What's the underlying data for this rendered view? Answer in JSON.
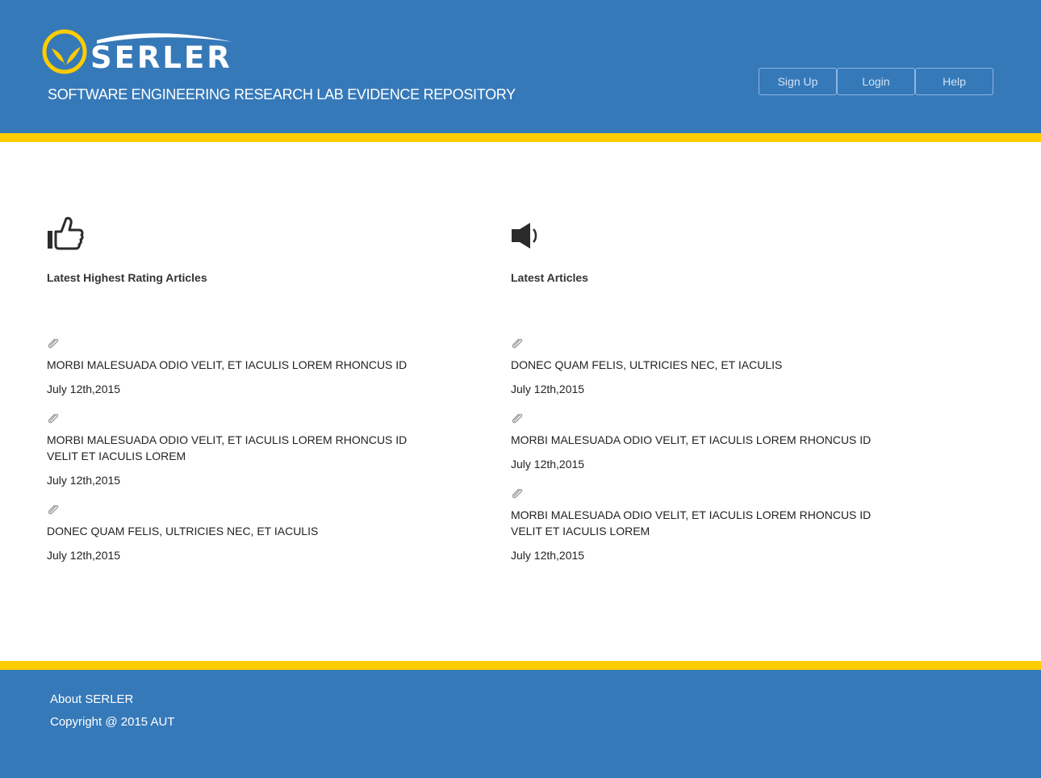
{
  "header": {
    "logo_text": "SERLER",
    "tagline": "SOFTWARE ENGINEERING RESEARCH LAB EVIDENCE REPOSITORY",
    "nav": [
      {
        "label": "Sign Up"
      },
      {
        "label": "Login"
      },
      {
        "label": "Help"
      }
    ]
  },
  "colors": {
    "primary_blue": "#3679b9",
    "accent_yellow": "#ffcc00"
  },
  "left_section": {
    "icon": "thumbs-up-icon",
    "title": "Latest Highest Rating Articles",
    "articles": [
      {
        "title": "MORBI MALESUADA ODIO VELIT, ET IACULIS LOREM RHONCUS ID",
        "date": "July 12th,2015"
      },
      {
        "title": "MORBI MALESUADA ODIO VELIT, ET IACULIS LOREM RHONCUS ID VELIT ET IACULIS LOREM",
        "date": "July 12th,2015"
      },
      {
        "title": "DONEC QUAM FELIS, ULTRICIES NEC, ET IACULIS",
        "date": "July 12th,2015"
      }
    ]
  },
  "right_section": {
    "icon": "megaphone-icon",
    "title": "Latest Articles",
    "articles": [
      {
        "title": "DONEC QUAM FELIS, ULTRICIES NEC, ET IACULIS",
        "date": "July 12th,2015"
      },
      {
        "title": "MORBI MALESUADA ODIO VELIT, ET IACULIS LOREM RHONCUS ID",
        "date": "July 12th,2015"
      },
      {
        "title": "MORBI MALESUADA ODIO VELIT, ET IACULIS LOREM RHONCUS ID VELIT ET IACULIS LOREM",
        "date": "July 12th,2015"
      }
    ]
  },
  "footer": {
    "about": "About SERLER",
    "copyright": "Copyright @ 2015 AUT"
  }
}
